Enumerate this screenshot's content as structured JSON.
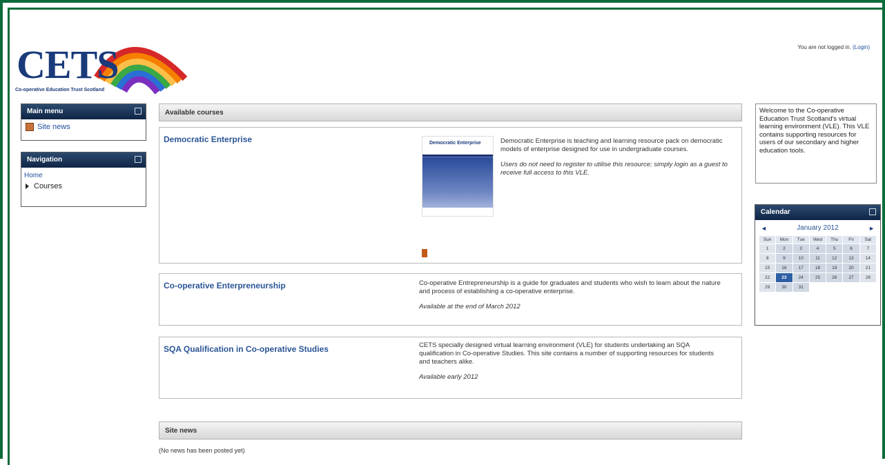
{
  "header": {
    "logo_text": "CETS",
    "logo_tagline": "Co-operative Education Trust Scotland",
    "login_text": "You are not logged in.",
    "login_link": "(Login)"
  },
  "main_menu": {
    "title": "Main menu",
    "items": [
      {
        "label": "Site news"
      }
    ]
  },
  "navigation": {
    "title": "Navigation",
    "home": "Home",
    "courses": "Courses"
  },
  "available_courses": {
    "title": "Available courses",
    "courses": [
      {
        "name": "Democratic Enterprise",
        "cover_title": "Democratic Enterprise",
        "description": "Democratic Enterprise is teaching and learning resource pack on democratic models of enterprise designed for use in undergraduate courses.",
        "note": "Users do not need to register to utilise this resource; simply login as a guest to receive full access to this VLE."
      },
      {
        "name": "Co-operative Enterpreneurship",
        "description": "Co-operative Entrepreneurship is a guide for graduates and students who wish to learn about the nature and process of establishing a co-operative enterprise.",
        "note": "Available at the end of March 2012"
      },
      {
        "name": "SQA Qualification in Co-operative Studies",
        "description": "CETS specially designed virtual learning environment (VLE) for students undertaking an SQA qualification in Co-operative Studies. This site contains a number of supporting resources for students and teachers alike.",
        "note": "Available early 2012"
      }
    ]
  },
  "site_news": {
    "title": "Site news",
    "empty": "(No news has been posted yet)"
  },
  "welcome": {
    "text": "Welcome to the Co-operative Education Trust Scotland's virtual learning environment (VLE). This VLE contains supporting resources for users of our secondary and higher education tools."
  },
  "calendar": {
    "title": "Calendar",
    "month": "January 2012",
    "prev": "◄",
    "next": "►",
    "weekdays": [
      "Sun",
      "Mon",
      "Tue",
      "Wed",
      "Thu",
      "Fri",
      "Sat"
    ],
    "today": 23,
    "colors": {
      "today": "#2e5fa3"
    }
  },
  "colors": {
    "frame": "#0b6b3a",
    "block_header": "#0f2545",
    "link": "#2a5595"
  }
}
